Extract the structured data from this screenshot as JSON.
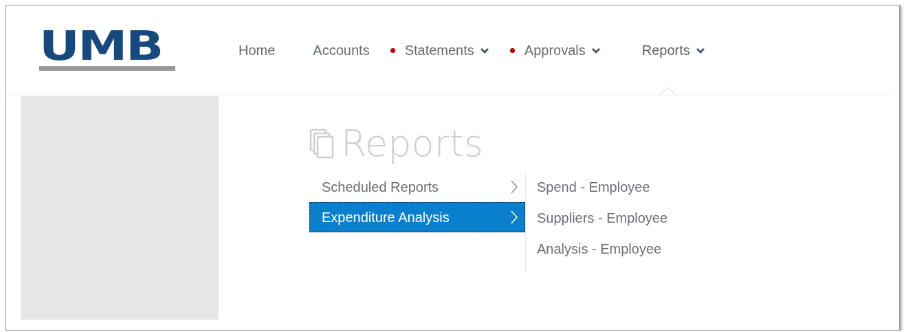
{
  "logo": {
    "text": "UMB"
  },
  "nav": [
    {
      "label": "Home",
      "alert": false,
      "dropdown": false,
      "selected": false
    },
    {
      "label": "Accounts",
      "alert": false,
      "dropdown": false,
      "selected": false
    },
    {
      "label": "Statements",
      "alert": true,
      "dropdown": true,
      "selected": false
    },
    {
      "label": "Approvals",
      "alert": true,
      "dropdown": true,
      "selected": false
    },
    {
      "label": "Reports",
      "alert": false,
      "dropdown": true,
      "selected": true
    }
  ],
  "page_title": "Reports",
  "menu": [
    {
      "label": "Scheduled Reports",
      "selected": false
    },
    {
      "label": "Expenditure Analysis",
      "selected": true
    }
  ],
  "submenu": [
    "Spend - Employee",
    "Suppliers - Employee",
    "Analysis - Employee"
  ]
}
